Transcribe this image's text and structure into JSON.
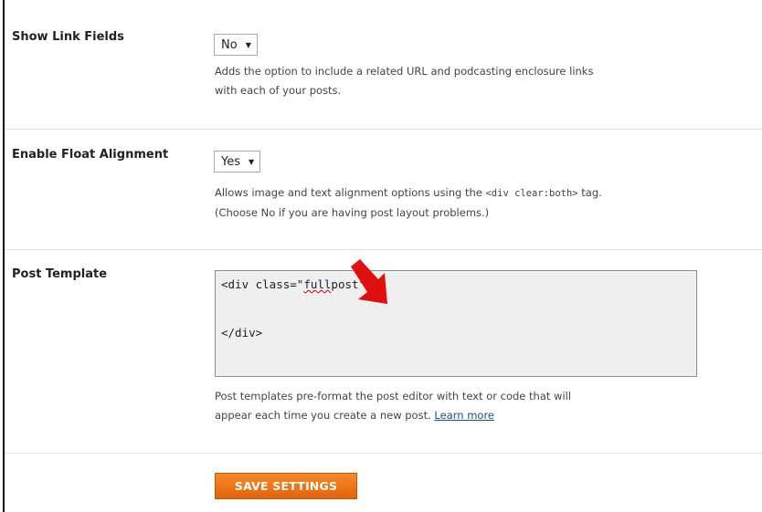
{
  "settings": {
    "show_link_fields": {
      "label": "Show Link Fields",
      "value": "No",
      "description_line1": "Adds the option to include a related URL and podcasting enclosure links",
      "description_line2": "with each of your posts."
    },
    "float_alignment": {
      "label": "Enable Float Alignment",
      "value": "Yes",
      "description_pre": "Allows image and text alignment options using the ",
      "description_code": "<div clear:both>",
      "description_post": " tag.",
      "description_line2": "(Choose No if you are having post layout problems.)"
    },
    "post_template": {
      "label": "Post Template",
      "text_pre": "<div class=\"",
      "text_misspelled": "full",
      "text_hidden": "post",
      "text_post": "\">",
      "text_line2": "</div>",
      "description_line1": "Post templates pre-format the post editor with text or code that will",
      "description_line2": "appear each time you create a new post. ",
      "learn_more": "Learn more"
    }
  },
  "save_button": {
    "label": "SAVE SETTINGS"
  },
  "colors": {
    "accent": "#ee7214",
    "arrow": "#e01010",
    "link": "#1a4f9c"
  }
}
